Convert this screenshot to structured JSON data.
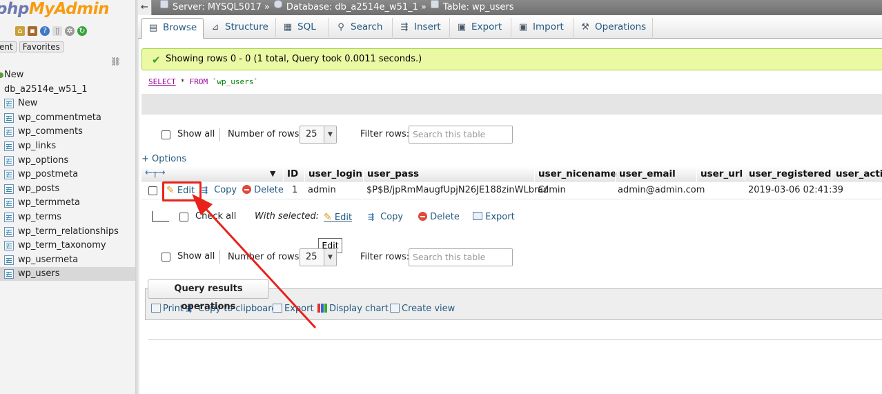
{
  "nav": {
    "logo_php": "php",
    "logo_myadmin": "MyAdmin",
    "tabs": [
      "ent",
      "Favorites"
    ],
    "items": [
      {
        "label": "New",
        "level": 0,
        "icon": "dot-icon"
      },
      {
        "label": "db_a2514e_w51_1",
        "level": 0,
        "icon": "none"
      },
      {
        "label": "New",
        "level": 1,
        "icon": "table-icon"
      },
      {
        "label": "wp_commentmeta",
        "level": 1,
        "icon": "table-icon"
      },
      {
        "label": "wp_comments",
        "level": 1,
        "icon": "table-icon"
      },
      {
        "label": "wp_links",
        "level": 1,
        "icon": "table-icon"
      },
      {
        "label": "wp_options",
        "level": 1,
        "icon": "table-icon"
      },
      {
        "label": "wp_postmeta",
        "level": 1,
        "icon": "table-icon"
      },
      {
        "label": "wp_posts",
        "level": 1,
        "icon": "table-icon"
      },
      {
        "label": "wp_termmeta",
        "level": 1,
        "icon": "table-icon"
      },
      {
        "label": "wp_terms",
        "level": 1,
        "icon": "table-icon"
      },
      {
        "label": "wp_term_relationships",
        "level": 1,
        "icon": "table-icon"
      },
      {
        "label": "wp_term_taxonomy",
        "level": 1,
        "icon": "table-icon"
      },
      {
        "label": "wp_usermeta",
        "level": 1,
        "icon": "table-icon"
      },
      {
        "label": "wp_users",
        "level": 1,
        "icon": "table-icon",
        "active": true
      }
    ]
  },
  "breadcrumb": {
    "server": "Server: MYSQL5017",
    "database": "Database: db_a2514e_w51_1",
    "table": "Table: wp_users",
    "separator": "»"
  },
  "tabs": [
    {
      "label": "Browse",
      "icon": "browse-icon",
      "active": true
    },
    {
      "label": "Structure",
      "icon": "structure-icon"
    },
    {
      "label": "SQL",
      "icon": "sql-icon"
    },
    {
      "label": "Search",
      "icon": "search-icon"
    },
    {
      "label": "Insert",
      "icon": "insert-icon"
    },
    {
      "label": "Export",
      "icon": "export-icon"
    },
    {
      "label": "Import",
      "icon": "import-icon"
    },
    {
      "label": "Operations",
      "icon": "wrench-icon"
    }
  ],
  "message": "Showing rows 0 - 0 (1 total, Query took 0.0011 seconds.)",
  "sql": {
    "select": "SELECT",
    "star": " * ",
    "from": "FROM",
    "table": " `wp_users`"
  },
  "controls": {
    "show_all": "Show all",
    "number_of_rows": "Number of rows:",
    "rows_value": "25",
    "filter_rows": "Filter rows:",
    "filter_placeholder": "Search this table"
  },
  "options_link": "+ Options",
  "table": {
    "columns": [
      "ID",
      "user_login",
      "user_pass",
      "user_nicename",
      "user_email",
      "user_url",
      "user_registered",
      "user_activa"
    ],
    "row": {
      "edit": "Edit",
      "copy": "Copy",
      "delete": "Delete",
      "cells": [
        "1",
        "admin",
        "$P$B/jpRmMaugfUpjN26JE188zinWLbrC/",
        "admin",
        "admin@admin.com",
        "",
        "2019-03-06 02:41:39",
        ""
      ]
    }
  },
  "bulk": {
    "check_all": "Check all",
    "with_selected": "With selected:",
    "edit": "Edit",
    "copy": "Copy",
    "delete": "Delete",
    "export": "Export"
  },
  "tooltip": "Edit",
  "query_ops": {
    "title": "Query results operations",
    "links": [
      "Print",
      "Copy to clipboard",
      "Export",
      "Display chart",
      "Create view"
    ]
  },
  "colors": {
    "annotation": "#e8221a",
    "link": "#235a81",
    "success_bg": "#ebf8a4"
  }
}
